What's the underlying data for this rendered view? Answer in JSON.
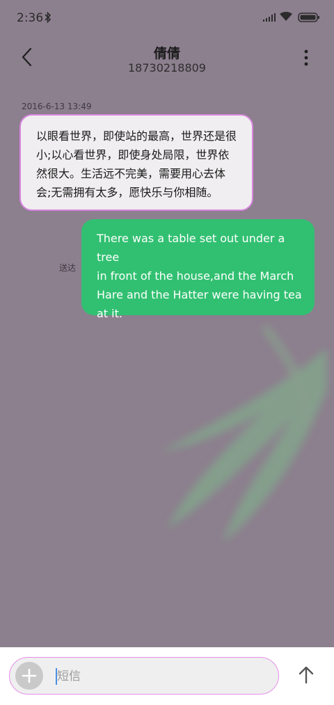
{
  "status_bar": {
    "time": "2:36",
    "icons": [
      "bluetooth-icon",
      "signal-icon",
      "wifi-icon",
      "battery-icon"
    ]
  },
  "header": {
    "contact_name": "倩倩",
    "contact_number": "18730218809",
    "icons": [
      "back-arrow-icon",
      "more-vertical-icon"
    ]
  },
  "conversation": {
    "timestamp": "2016-6-13 13:49",
    "incoming_message": {
      "lines": [
        "以眼看世界，即使站的最高，世界还是很",
        "小;以心看世界，即使身处局限，世界依",
        "然很大。生活远不完美，需要用心去体",
        "会;无需拥有太多，愿快乐与你相随。"
      ]
    },
    "outgoing_message": {
      "lines": [
        "There was a table set out under a tree",
        "in front of the house,and the March",
        "Hare and the Hatter were having tea",
        "at it."
      ],
      "status": "送达"
    }
  },
  "composer": {
    "placeholder": "短信",
    "icons": [
      "plus-icon",
      "send-arrow-icon"
    ]
  },
  "colors": {
    "background": "#8c7f8e",
    "incoming_bubble": "#f0eef0",
    "incoming_border": "#d884de",
    "outgoing_bubble": "#31c071",
    "composer_border": "#e58ee8"
  }
}
